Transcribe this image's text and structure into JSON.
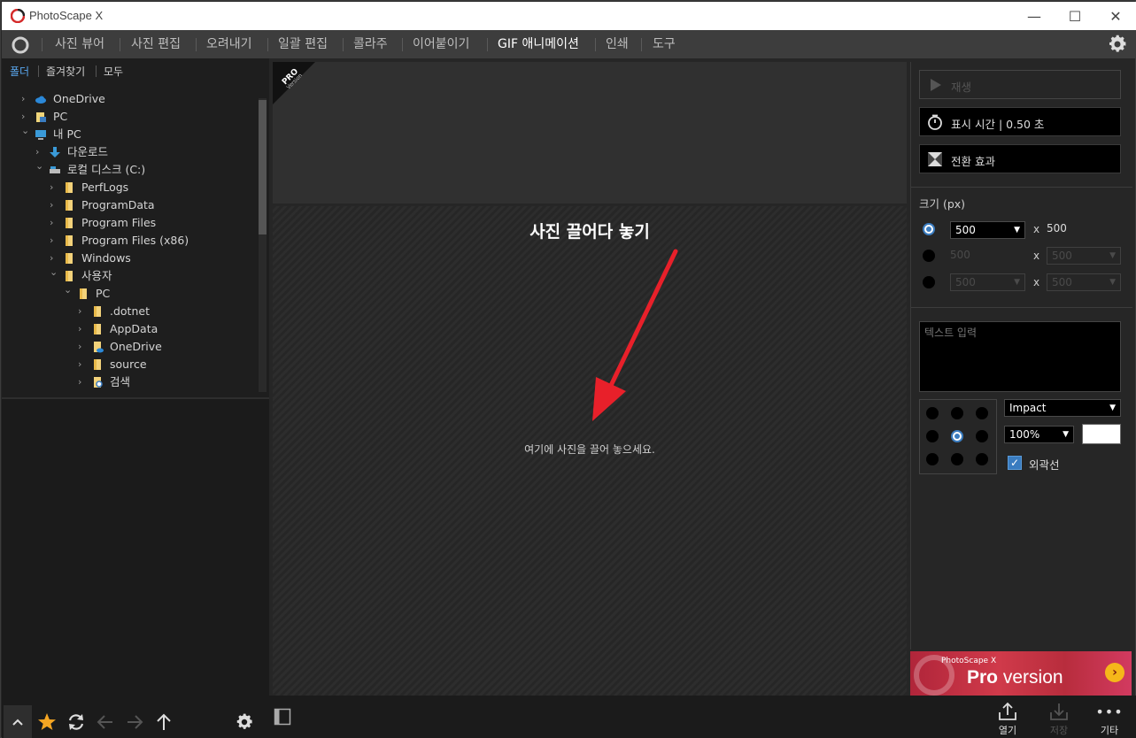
{
  "window": {
    "title": "PhotoScape X",
    "minimize": "—",
    "maximize": "☐",
    "close": "✕"
  },
  "menu": {
    "items": [
      "사진 뷰어",
      "사진 편집",
      "오려내기",
      "일괄 편집",
      "콜라주",
      "이어붙이기",
      "GIF 애니메이션",
      "인쇄",
      "도구"
    ],
    "active": "GIF 애니메이션"
  },
  "left": {
    "tabs": [
      "폴더",
      "즐겨찾기",
      "모두"
    ],
    "active_tab": "폴더",
    "tree": [
      {
        "label": "OneDrive",
        "icon": "cloud-icon",
        "expanded": false,
        "depth": 0
      },
      {
        "label": "PC",
        "icon": "pc-folder-icon",
        "expanded": false,
        "depth": 0
      },
      {
        "label": "내 PC",
        "icon": "computer-icon",
        "expanded": true,
        "depth": 0
      },
      {
        "label": "다운로드",
        "icon": "download-icon",
        "expanded": false,
        "depth": 1
      },
      {
        "label": "로컬 디스크 (C:)",
        "icon": "drive-icon",
        "expanded": true,
        "depth": 1
      },
      {
        "label": "PerfLogs",
        "icon": "folder-icon",
        "expanded": false,
        "depth": 2
      },
      {
        "label": "ProgramData",
        "icon": "folder-icon",
        "expanded": false,
        "depth": 2
      },
      {
        "label": "Program Files",
        "icon": "folder-icon",
        "expanded": false,
        "depth": 2
      },
      {
        "label": "Program Files (x86)",
        "icon": "folder-icon",
        "expanded": false,
        "depth": 2
      },
      {
        "label": "Windows",
        "icon": "folder-icon",
        "expanded": false,
        "depth": 2
      },
      {
        "label": "사용자",
        "icon": "folder-icon",
        "expanded": true,
        "depth": 2
      },
      {
        "label": "PC",
        "icon": "folder-icon",
        "expanded": true,
        "depth": 3
      },
      {
        "label": ".dotnet",
        "icon": "folder-icon",
        "expanded": false,
        "depth": 4
      },
      {
        "label": "AppData",
        "icon": "folder-icon",
        "expanded": false,
        "depth": 4
      },
      {
        "label": "OneDrive",
        "icon": "onedrive-folder-icon",
        "expanded": false,
        "depth": 4
      },
      {
        "label": "source",
        "icon": "folder-icon",
        "expanded": false,
        "depth": 4
      },
      {
        "label": "검색",
        "icon": "search-folder-icon",
        "expanded": false,
        "depth": 4
      }
    ]
  },
  "center": {
    "pro_badge": "PRO",
    "pro_badge_sub": "Version",
    "callout": "사진 끌어다 놓기",
    "drop_hint": "여기에 사진을 끌어 놓으세요."
  },
  "right": {
    "play_label": "재생",
    "display_time_label": "표시 시간 | 0.50 초",
    "transition_label": "전환 효과",
    "size_label": "크기 (px)",
    "size_rows": [
      {
        "selected": true,
        "width": "500",
        "height": "500"
      },
      {
        "selected": false,
        "width": "500",
        "height": "500"
      },
      {
        "selected": false,
        "width": "500",
        "height": "500"
      }
    ],
    "x_sep": "x",
    "text_placeholder": "텍스트 입력",
    "text_position_selected": "middle-center",
    "font": "Impact",
    "opacity": "100%",
    "text_color": "#ffffff",
    "outline_label": "외곽선",
    "outline_checked": true
  },
  "ad": {
    "small": "PhotoScape X",
    "big_bold": "Pro",
    "big_rest": " version"
  },
  "bottom": {
    "open_label": "열기",
    "save_label": "저장",
    "more_label": "기타"
  },
  "colors": {
    "accent": "#3a7cc0",
    "star": "#f5a623",
    "menu_bg": "#3d3d3d",
    "panel_bg": "#262626"
  }
}
